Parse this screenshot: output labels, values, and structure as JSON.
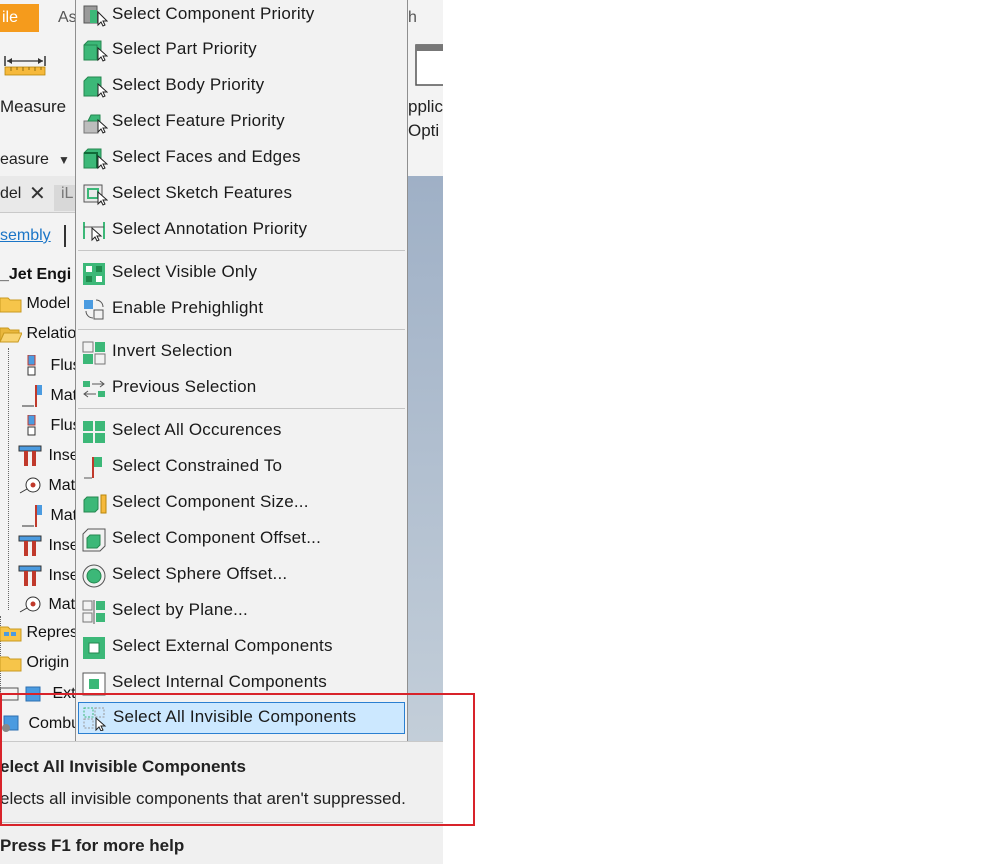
{
  "ribbon": {
    "file_tab": "ile",
    "tab_assemble": "As",
    "tab_right": "h",
    "measure_label": "Measure",
    "measure_dropdown": "easure",
    "right_btn_line1": "pplic",
    "right_btn_line2": "Opti"
  },
  "browser": {
    "tab_model": "del",
    "tab_other": "iL",
    "assembly_link": "sembly",
    "root": "_Jet Engi",
    "items": [
      {
        "label": "Model",
        "icon": "folder-icon"
      },
      {
        "label": "Relatio",
        "icon": "folder-open-icon"
      },
      {
        "label": "Flus",
        "icon": "flush-constraint-icon"
      },
      {
        "label": "Mat",
        "icon": "mate-constraint-icon"
      },
      {
        "label": "Flus",
        "icon": "flush-constraint-icon"
      },
      {
        "label": "Inse",
        "icon": "insert-constraint-icon"
      },
      {
        "label": "Mat",
        "icon": "mate-point-icon"
      },
      {
        "label": "Mat",
        "icon": "mate-constraint-icon"
      },
      {
        "label": "Inse",
        "icon": "insert-constraint-icon"
      },
      {
        "label": "Inse",
        "icon": "insert-constraint-icon"
      },
      {
        "label": "Mat",
        "icon": "mate-point-icon"
      },
      {
        "label": "Repres",
        "icon": "representations-icon"
      },
      {
        "label": "Origin",
        "icon": "folder-icon"
      },
      {
        "label": "Ext",
        "icon": "component-icon"
      },
      {
        "label": "Combu",
        "icon": "assembly-component-icon"
      }
    ]
  },
  "menu": {
    "items": [
      {
        "label": "Select Component Priority",
        "icon": "component-priority-icon"
      },
      {
        "label": "Select Part Priority",
        "icon": "part-priority-icon"
      },
      {
        "label": "Select Body Priority",
        "icon": "body-priority-icon"
      },
      {
        "label": "Select Feature Priority",
        "icon": "feature-priority-icon"
      },
      {
        "label": "Select Faces and Edges",
        "icon": "faces-edges-icon"
      },
      {
        "label": "Select Sketch Features",
        "icon": "sketch-features-icon"
      },
      {
        "label": "Select Annotation Priority",
        "icon": "annotation-priority-icon"
      },
      {
        "label": "Select Visible Only",
        "icon": "visible-only-icon"
      },
      {
        "label": "Enable Prehighlight",
        "icon": "prehighlight-icon"
      },
      {
        "label": "Invert Selection",
        "icon": "invert-selection-icon"
      },
      {
        "label": "Previous Selection",
        "icon": "previous-selection-icon"
      },
      {
        "label": "Select All Occurences",
        "icon": "all-occurrences-icon"
      },
      {
        "label": "Select Constrained To",
        "icon": "constrained-to-icon"
      },
      {
        "label": "Select Component Size...",
        "icon": "component-size-icon"
      },
      {
        "label": "Select Component Offset...",
        "icon": "component-offset-icon"
      },
      {
        "label": "Select Sphere Offset...",
        "icon": "sphere-offset-icon"
      },
      {
        "label": "Select by Plane...",
        "icon": "by-plane-icon"
      },
      {
        "label": "Select External Components",
        "icon": "external-components-icon"
      },
      {
        "label": "Select Internal Components",
        "icon": "internal-components-icon"
      },
      {
        "label": "Select All Invisible Components",
        "icon": "invisible-components-icon"
      }
    ],
    "highlighted": "Select All Invisible Components"
  },
  "tooltip": {
    "title": "elect All Invisible Components",
    "description": "elects all invisible components that aren't suppressed.",
    "help": "Press F1 for more help"
  },
  "colors": {
    "accent_green": "#3cb878",
    "file_tab_orange": "#f59b1c",
    "highlight_bg": "#cce8ff",
    "highlight_border": "#2a7fd1",
    "callout_red": "#d8232a"
  }
}
